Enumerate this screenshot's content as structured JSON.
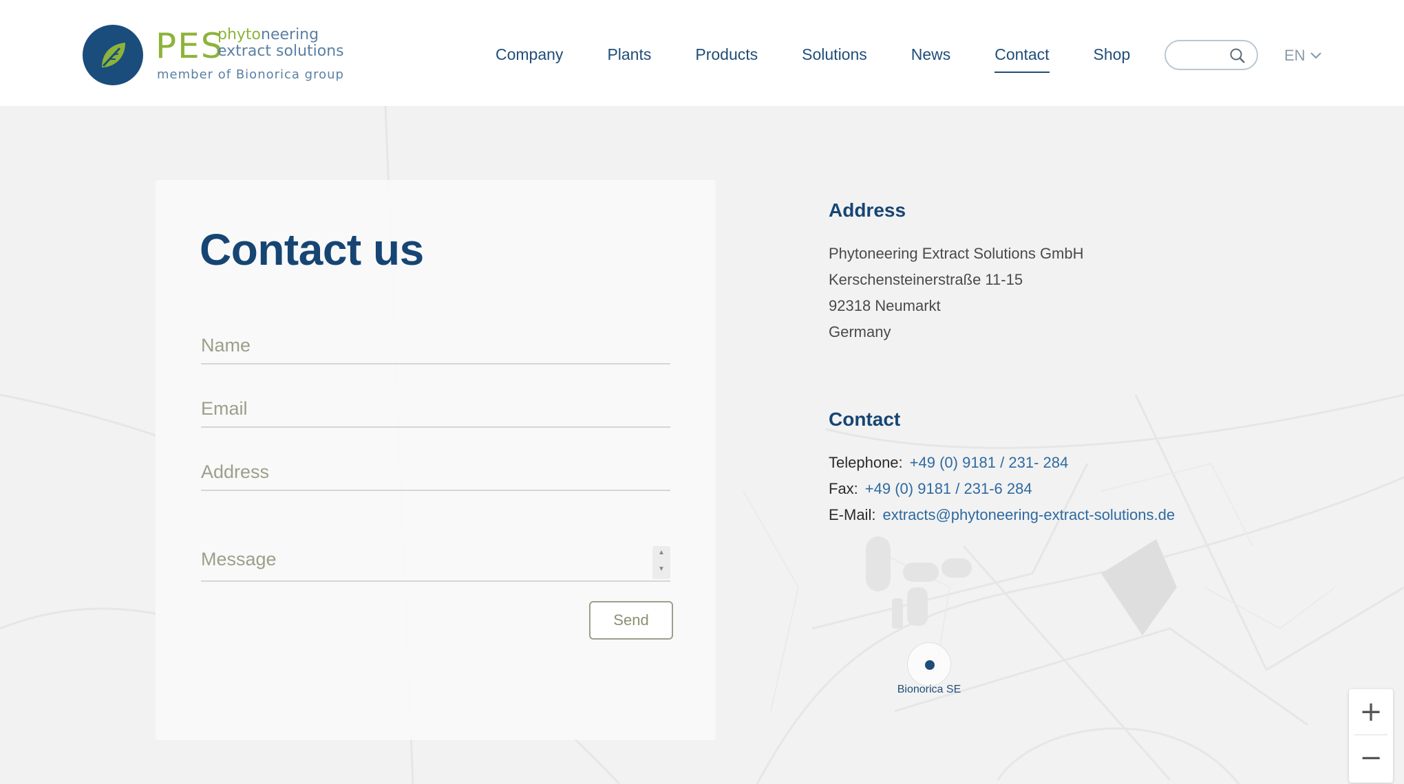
{
  "header": {
    "logo": {
      "main": "PES",
      "sub_a": "phyto",
      "sub_b": "neering",
      "sub2": "extract solutions",
      "member": "member of Bionorica group"
    },
    "nav": [
      "Company",
      "Plants",
      "Products",
      "Solutions",
      "News",
      "Contact",
      "Shop"
    ],
    "active_nav": "Contact",
    "search": {
      "placeholder": ""
    },
    "language": "EN"
  },
  "form": {
    "title": "Contact us",
    "name_placeholder": "Name",
    "email_placeholder": "Email",
    "address_placeholder": "Address",
    "message_placeholder": "Message",
    "send_label": "Send"
  },
  "address": {
    "heading": "Address",
    "lines": [
      "Phytoneering Extract Solutions GmbH",
      "Kerschensteinerstraße 11-15",
      "92318 Neumarkt",
      "Germany"
    ]
  },
  "contact": {
    "heading": "Contact",
    "telephone_label": "Telephone:",
    "telephone": "+49 (0) 9181 / 231- 284",
    "fax_label": "Fax:",
    "fax": "+49 (0) 9181 / 231-6 284",
    "email_label": "E-Mail:",
    "email": "extracts@phytoneering-extract-solutions.de"
  },
  "map": {
    "marker_label": "Bionorica SE",
    "zoom_in": "+",
    "zoom_out": "−"
  },
  "colors": {
    "brand_blue": "#164574",
    "brand_green": "#8db33a",
    "link": "#2e6aa0"
  }
}
